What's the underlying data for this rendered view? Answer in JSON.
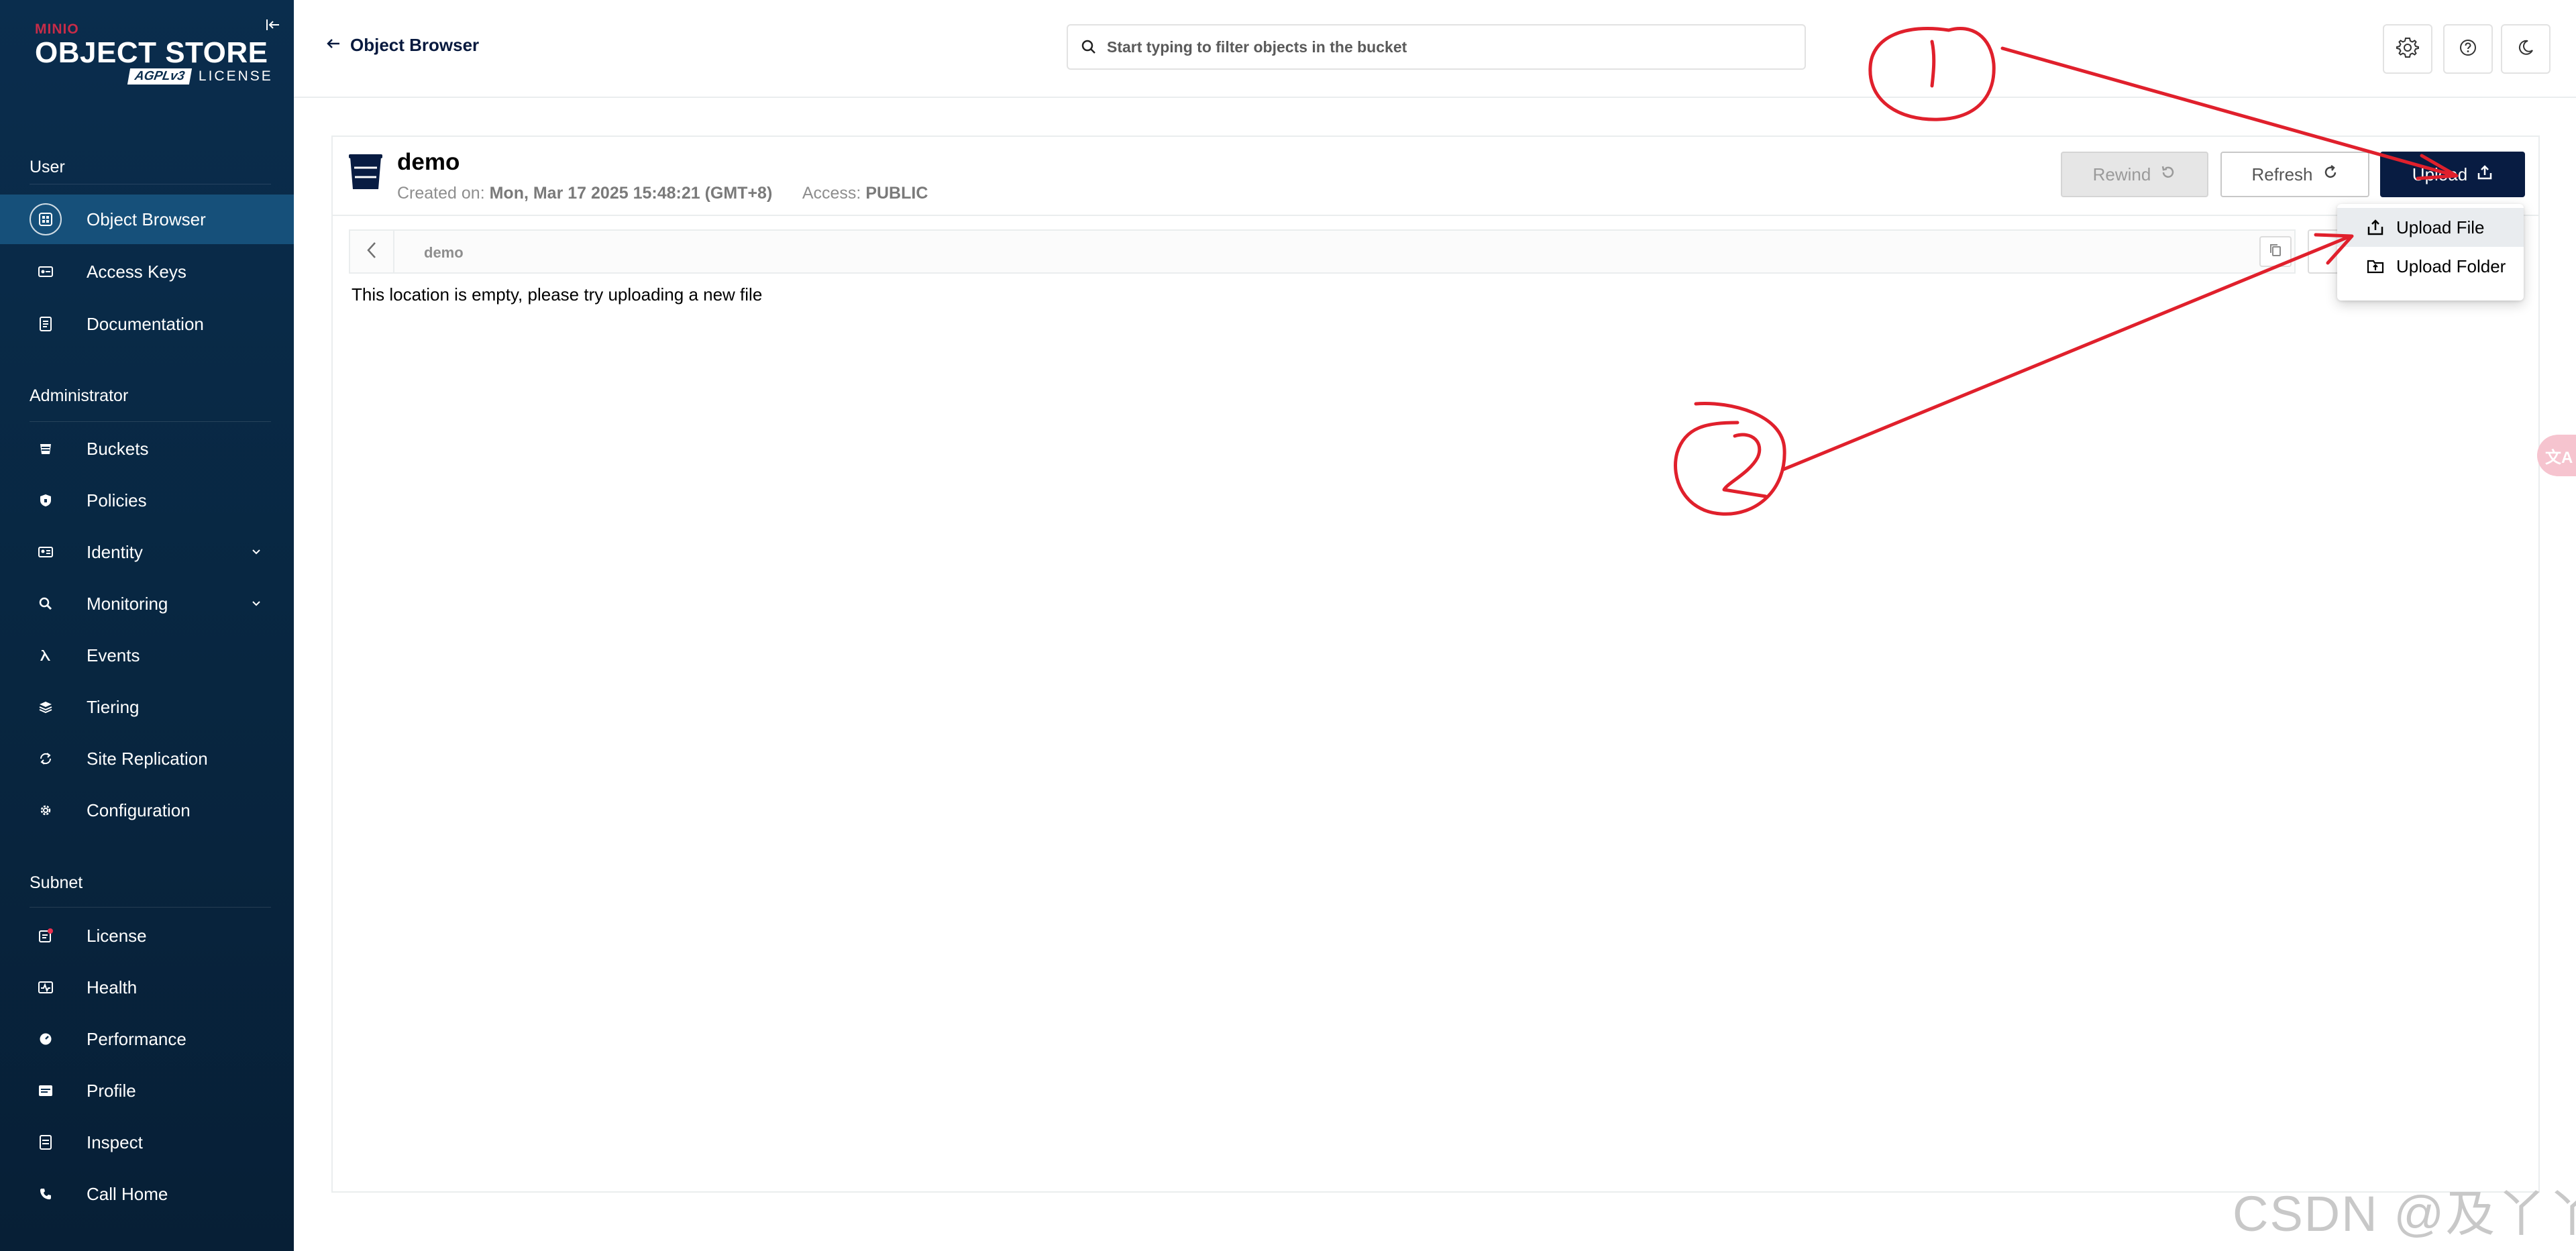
{
  "colors": {
    "sidebar_bg": "#0a2d4d",
    "sidebar_active": "#16507a",
    "brand_red": "#c72c48",
    "upload_btn_bg": "#081c42",
    "annotation_red": "#e0202c"
  },
  "brand": {
    "minio": "MINIO",
    "product": "OBJECT STORE",
    "agpl": "AGPLv3",
    "license": "LICENSE"
  },
  "sidebar": {
    "sections": {
      "user": "User",
      "administrator": "Administrator",
      "subnet": "Subnet"
    },
    "user_items": [
      {
        "label": "Object Browser",
        "icon": "object-browser-icon"
      },
      {
        "label": "Access Keys",
        "icon": "key-icon"
      },
      {
        "label": "Documentation",
        "icon": "document-icon"
      }
    ],
    "admin_items": [
      {
        "label": "Buckets",
        "icon": "bucket-icon"
      },
      {
        "label": "Policies",
        "icon": "shield-icon"
      },
      {
        "label": "Identity",
        "icon": "identity-icon"
      },
      {
        "label": "Monitoring",
        "icon": "magnifier-icon"
      },
      {
        "label": "Events",
        "icon": "lambda-icon"
      },
      {
        "label": "Tiering",
        "icon": "layers-icon"
      },
      {
        "label": "Site Replication",
        "icon": "replication-icon"
      },
      {
        "label": "Configuration",
        "icon": "gear-icon"
      }
    ],
    "subnet_items": [
      {
        "label": "License",
        "icon": "license-icon"
      },
      {
        "label": "Health",
        "icon": "health-icon"
      },
      {
        "label": "Performance",
        "icon": "speedometer-icon"
      },
      {
        "label": "Profile",
        "icon": "profile-icon"
      },
      {
        "label": "Inspect",
        "icon": "inspect-icon"
      },
      {
        "label": "Call Home",
        "icon": "phone-icon"
      }
    ]
  },
  "topbar": {
    "back_label": "Object Browser",
    "search_placeholder": "Start typing to filter objects in the bucket"
  },
  "bucket": {
    "name": "demo",
    "created_label": "Created on:",
    "created_value": "Mon, Mar 17 2025 15:48:21 (GMT+8)",
    "access_label": "Access:",
    "access_value": "PUBLIC"
  },
  "actions": {
    "rewind": "Rewind",
    "refresh": "Refresh",
    "upload": "Upload"
  },
  "path": {
    "current": "demo"
  },
  "empty_message": "This location is empty, please try uploading a new file",
  "upload_menu": {
    "items": [
      {
        "label": "Upload File",
        "icon": "upload-file-icon"
      },
      {
        "label": "Upload Folder",
        "icon": "upload-folder-icon"
      }
    ]
  },
  "translate_bubble": "文A",
  "watermark": "CSDN @及丫丫"
}
